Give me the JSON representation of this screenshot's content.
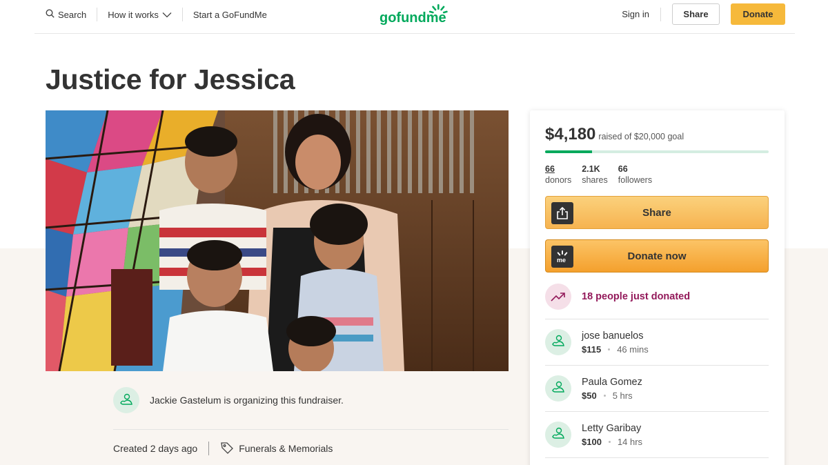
{
  "nav": {
    "search_label": "Search",
    "how_label": "How it works",
    "start_label": "Start a GoFundMe",
    "logo_text": "gofundme",
    "signin_label": "Sign in",
    "share_label": "Share",
    "donate_label": "Donate"
  },
  "campaign": {
    "title": "Justice for Jessica",
    "organizer_text": "Jackie Gastelum is organizing this fundraiser.",
    "created": "Created 2 days ago",
    "category": "Funerals & Memorials"
  },
  "card": {
    "amount": "$4,180",
    "goal_text": "raised of $20,000 goal",
    "progress_fraction": 0.209,
    "stats": [
      {
        "num": "66",
        "label": "donors"
      },
      {
        "num": "2.1K",
        "label": "shares"
      },
      {
        "num": "66",
        "label": "followers"
      }
    ],
    "share_label": "Share",
    "donate_label": "Donate now",
    "recent_text": "18 people just donated",
    "donations": [
      {
        "name": "jose banuelos",
        "amount": "$115",
        "time": "46 mins"
      },
      {
        "name": "Paula Gomez",
        "amount": "$50",
        "time": "5 hrs"
      },
      {
        "name": "Letty Garibay",
        "amount": "$100",
        "time": "14 hrs"
      }
    ]
  },
  "colors": {
    "brand_green": "#02a95c",
    "donate_orange": "#f6b93b",
    "recent_purple": "#93195a"
  }
}
